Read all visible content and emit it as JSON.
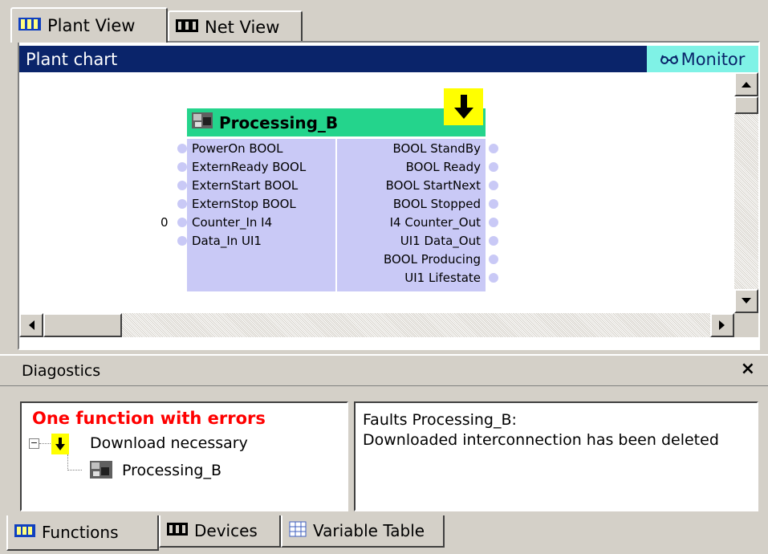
{
  "tabs": {
    "plant_view": "Plant View",
    "net_view": "Net View"
  },
  "panel": {
    "title": "Plant chart",
    "monitor": "Monitor"
  },
  "block": {
    "name": "Processing_B",
    "inputs": [
      "PowerOn  BOOL",
      "ExternReady  BOOL",
      "ExternStart  BOOL",
      "ExternStop  BOOL",
      "Counter_In  I4",
      "Data_In  UI1"
    ],
    "outputs": [
      "BOOL  StandBy",
      "BOOL  Ready",
      "BOOL  StartNext",
      "BOOL  Stopped",
      "I4  Counter_Out",
      "UI1  Data_Out",
      "BOOL  Producing",
      "UI1  Lifestate"
    ],
    "counter_value": "0"
  },
  "diagnostics": {
    "title": "Diagostics",
    "close": "×",
    "error_header": "One function with errors",
    "tree_node": "Download necessary",
    "tree_child": "Processing_B",
    "faults_title": "Faults Processing_B:",
    "faults_message": "Downloaded interconnection has been deleted"
  },
  "bottom_tabs": {
    "functions": "Functions",
    "devices": "Devices",
    "variable_table": "Variable Table"
  },
  "colors": {
    "title_bar": "#0a246a",
    "monitor_bg": "#7ff2e6",
    "block_header": "#24d48c",
    "block_body": "#c9c9f6",
    "download_badge": "#ffff00",
    "error_text": "#ff0000"
  }
}
